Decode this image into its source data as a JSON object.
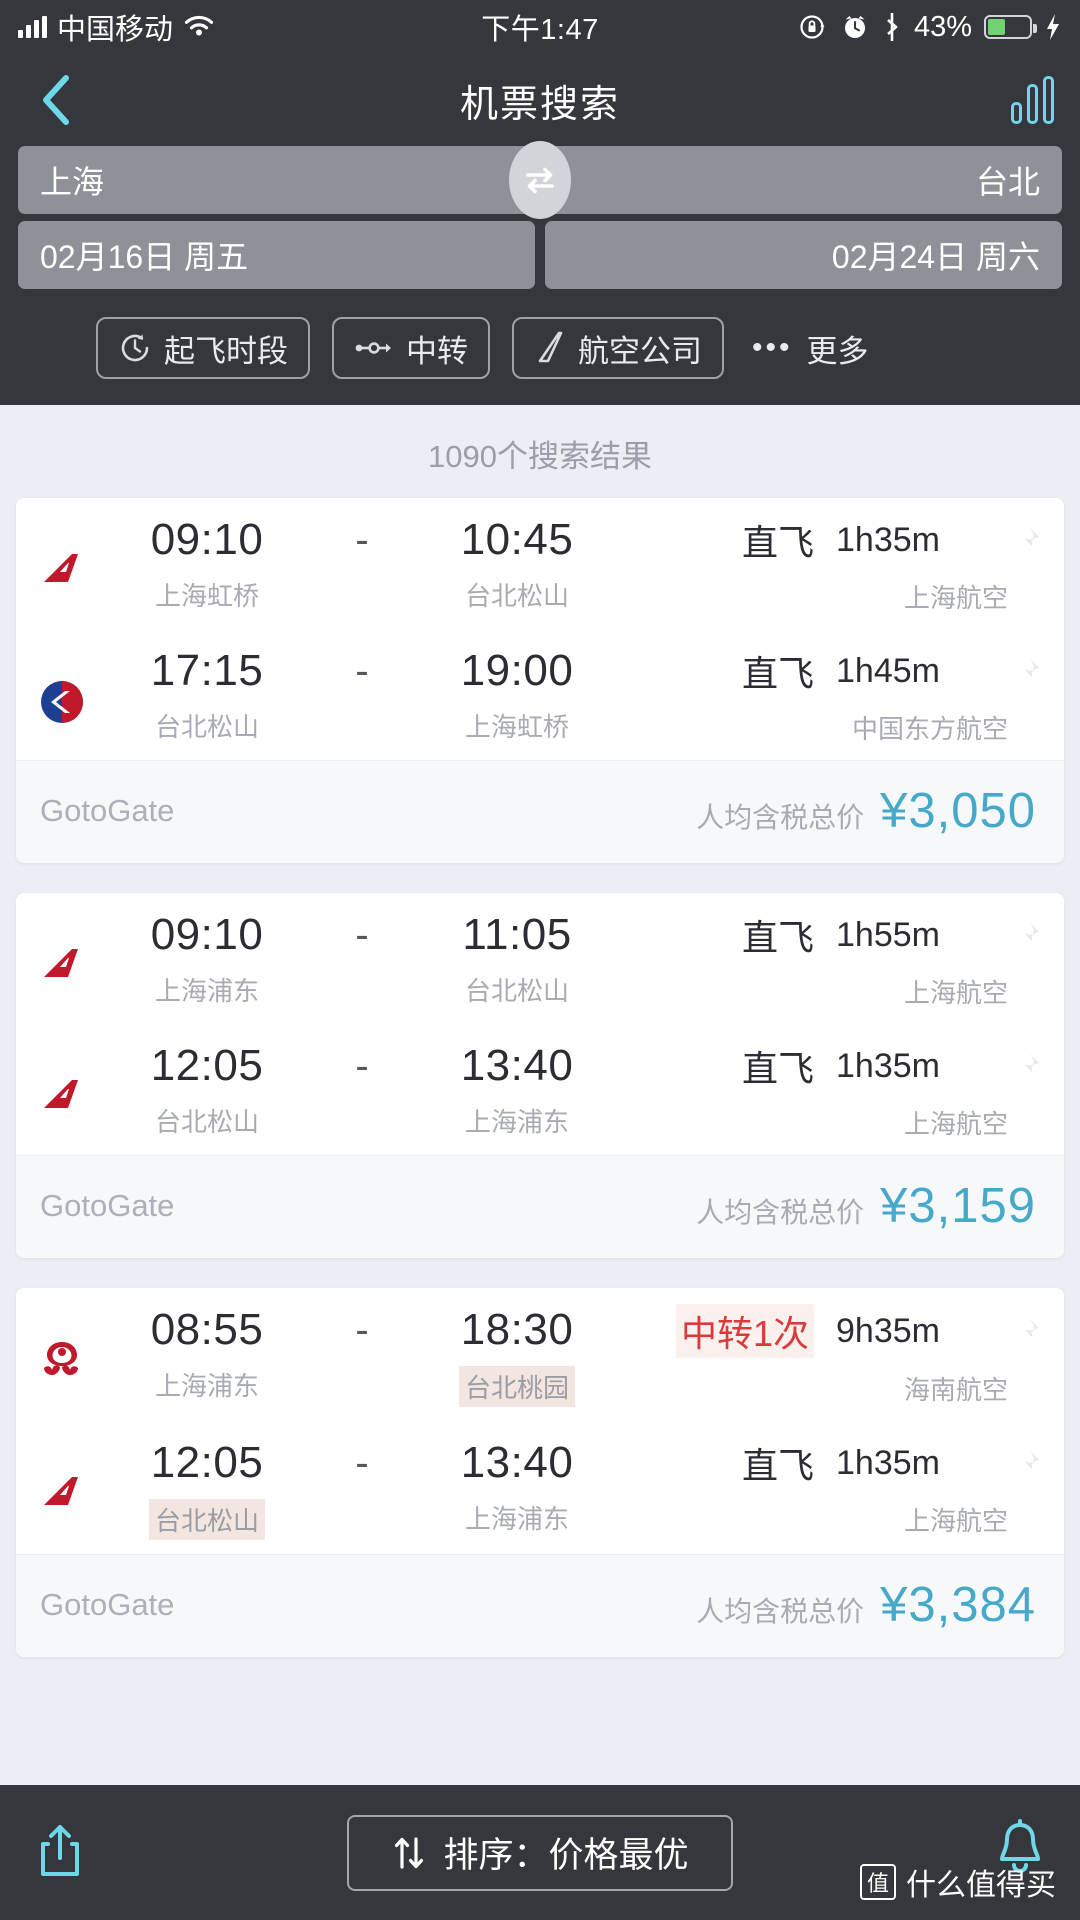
{
  "status_bar": {
    "carrier": "中国移动",
    "time": "下午1:47",
    "battery_percent": "43%",
    "battery_level": 43,
    "icons": [
      "signal-icon",
      "wifi-icon",
      "rotation-lock-icon",
      "alarm-clock-icon",
      "bluetooth-icon",
      "battery-icon",
      "charging-bolt-icon"
    ]
  },
  "navbar": {
    "back_icon": "chevron-left-icon",
    "title": "机票搜索",
    "chart_icon": "bar-chart-icon"
  },
  "search": {
    "origin": "上海",
    "destination": "台北",
    "swap_icon": "swap-arrows-icon",
    "depart_date": "02月16日 周五",
    "return_date": "02月24日 周六"
  },
  "filters": [
    {
      "label": "起飞时段",
      "icon": "clock-icon"
    },
    {
      "label": "中转",
      "icon": "transfer-icon"
    },
    {
      "label": "航空公司",
      "icon": "tail-fin-icon"
    }
  ],
  "more_filter": {
    "label": "更多",
    "icon": "ellipsis-icon"
  },
  "results": {
    "count_text": "1090个搜索结果",
    "price_label": "人均含税总价",
    "cards": [
      {
        "agency": "GotoGate",
        "price": "¥3,050",
        "legs": [
          {
            "logo": "shanghai-airlines-logo",
            "depart_time": "09:10",
            "dash": "-",
            "arrive_time": "10:45",
            "depart_airport": "上海虹桥",
            "arrive_airport": "台北松山",
            "depart_highlight": false,
            "arrive_highlight": false,
            "stops": "直飞",
            "stops_transfer": false,
            "duration": "1h35m",
            "airline": "上海航空",
            "pin_icon": "pin-icon"
          },
          {
            "logo": "china-eastern-logo",
            "depart_time": "17:15",
            "dash": "-",
            "arrive_time": "19:00",
            "depart_airport": "台北松山",
            "arrive_airport": "上海虹桥",
            "depart_highlight": false,
            "arrive_highlight": false,
            "stops": "直飞",
            "stops_transfer": false,
            "duration": "1h45m",
            "airline": "中国东方航空",
            "pin_icon": "pin-icon"
          }
        ]
      },
      {
        "agency": "GotoGate",
        "price": "¥3,159",
        "legs": [
          {
            "logo": "shanghai-airlines-logo",
            "depart_time": "09:10",
            "dash": "-",
            "arrive_time": "11:05",
            "depart_airport": "上海浦东",
            "arrive_airport": "台北松山",
            "depart_highlight": false,
            "arrive_highlight": false,
            "stops": "直飞",
            "stops_transfer": false,
            "duration": "1h55m",
            "airline": "上海航空",
            "pin_icon": "pin-icon"
          },
          {
            "logo": "shanghai-airlines-logo",
            "depart_time": "12:05",
            "dash": "-",
            "arrive_time": "13:40",
            "depart_airport": "台北松山",
            "arrive_airport": "上海浦东",
            "depart_highlight": false,
            "arrive_highlight": false,
            "stops": "直飞",
            "stops_transfer": false,
            "duration": "1h35m",
            "airline": "上海航空",
            "pin_icon": "pin-icon"
          }
        ]
      },
      {
        "agency": "GotoGate",
        "price": "¥3,384",
        "legs": [
          {
            "logo": "hainan-airlines-logo",
            "depart_time": "08:55",
            "dash": "-",
            "arrive_time": "18:30",
            "depart_airport": "上海浦东",
            "arrive_airport": "台北桃园",
            "depart_highlight": false,
            "arrive_highlight": true,
            "stops": "中转1次",
            "stops_transfer": true,
            "duration": "9h35m",
            "airline": "海南航空",
            "pin_icon": "pin-icon"
          },
          {
            "logo": "shanghai-airlines-logo",
            "depart_time": "12:05",
            "dash": "-",
            "arrive_time": "13:40",
            "depart_airport": "台北松山",
            "arrive_airport": "上海浦东",
            "depart_highlight": true,
            "arrive_highlight": false,
            "stops": "直飞",
            "stops_transfer": false,
            "duration": "1h35m",
            "airline": "上海航空",
            "pin_icon": "pin-icon"
          }
        ]
      }
    ]
  },
  "bottom_bar": {
    "share_icon": "share-icon",
    "sort_label": "排序：价格最优",
    "sort_icon": "sort-arrows-icon",
    "bell_icon": "bell-icon"
  },
  "watermark": {
    "badge": "值",
    "text": "什么值得买"
  },
  "colors": {
    "chrome_dark": "#35373d",
    "page_bg": "#eceef5",
    "accent_cyan": "#6fd8e8",
    "price_blue": "#47a9c9",
    "transfer_red": "#d93a3a",
    "field_gray": "#8e9198",
    "battery_green": "#6fd36f"
  }
}
